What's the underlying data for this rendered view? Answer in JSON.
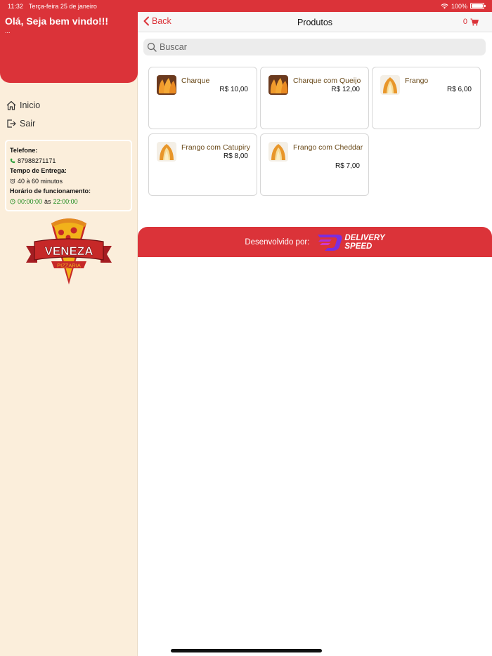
{
  "status_bar": {
    "time": "11:32",
    "date": "Terça-feira 25 de janeiro",
    "battery": "100%",
    "battery_level": 1.0
  },
  "colors": {
    "brand_red": "#db3339",
    "sidebar_bg": "#fbeedb",
    "product_name": "#6a4a1a",
    "hours_green": "#1e8b1e"
  },
  "sidebar": {
    "greeting": "Olá, Seja bem vindo!!!",
    "subtext": "...",
    "menu": [
      {
        "label": "Inicio",
        "icon": "home-icon"
      },
      {
        "label": "Sair",
        "icon": "logout-icon"
      }
    ],
    "info": {
      "phone_label": "Telefone:",
      "phone": "87988271171",
      "delivery_label": "Tempo de Entrega:",
      "delivery_time": "40 à 60 minutos",
      "hours_label": "Horário de funcionamento:",
      "hours_open": "00:00:00",
      "hours_sep": "às",
      "hours_close": "22:00:00"
    },
    "logo": {
      "name": "VENEZA",
      "tagline": "PIZZARIA"
    }
  },
  "header": {
    "back_label": "Back",
    "title": "Produtos",
    "cart_count": "0"
  },
  "search": {
    "placeholder": "Buscar"
  },
  "products": [
    {
      "name": "Charque",
      "price": "R$ 10,00",
      "thumb": "coxinha-image"
    },
    {
      "name": "Charque com Queijo",
      "price": "R$ 12,00",
      "thumb": "coxinha-image"
    },
    {
      "name": "Frango",
      "price": "R$ 6,00",
      "thumb": "coxinha-cut-image"
    },
    {
      "name": "Frango com Catupiry",
      "price": "R$ 8,00",
      "thumb": "coxinha-cut-image"
    },
    {
      "name": "Frango com Cheddar",
      "price": "R$ 7,00",
      "thumb": "coxinha-cut-image"
    }
  ],
  "footer": {
    "developed_by": "Desenvolvido por:",
    "brand_line1": "DELIVERY",
    "brand_line2": "SPEED"
  }
}
